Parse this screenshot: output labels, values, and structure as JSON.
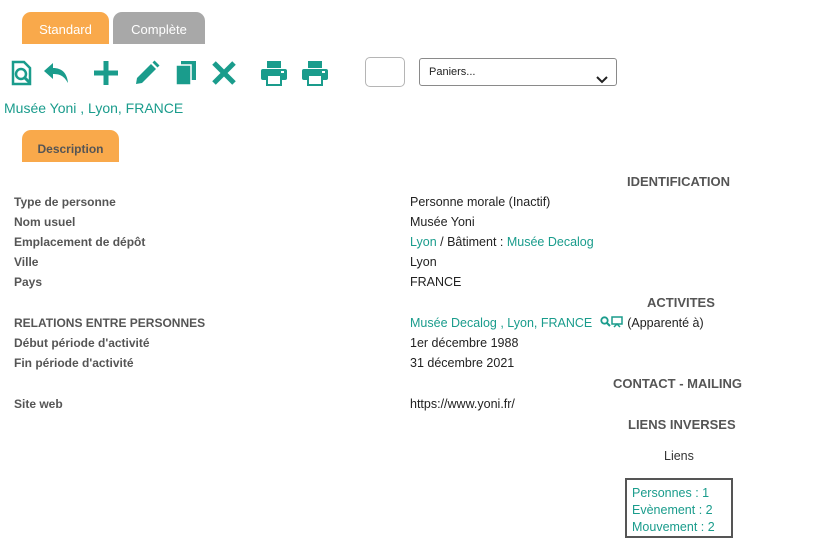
{
  "tabs": {
    "standard": "Standard",
    "complete": "Complète"
  },
  "toolbar": {
    "icons": [
      "search-document-icon",
      "undo-icon",
      "add-icon",
      "edit-icon",
      "copy-icon",
      "delete-icon",
      "print-icon",
      "print-alt-icon"
    ],
    "accent_color": "#1a9c8c",
    "basket_select": "Paniers..."
  },
  "header": {
    "title": "Musée Yoni , Lyon, FRANCE"
  },
  "description_tab": "Description",
  "sections": {
    "identification": "IDENTIFICATION",
    "activites": "ACTIVITES",
    "contact": "CONTACT - MAILING",
    "liens_inverses": "LIENS INVERSES"
  },
  "fields": {
    "type_label": "Type de personne",
    "type_value": "Personne morale (Inactif)",
    "nom_label": "Nom usuel",
    "nom_value": "Musée Yoni",
    "emplacement_label": "Emplacement de dépôt",
    "emplacement_lyon": "Lyon",
    "emplacement_sep": "/  Bâtiment :",
    "emplacement_batiment": "Musée Decalog",
    "ville_label": "Ville",
    "ville_value": "Lyon",
    "pays_label": "Pays",
    "pays_value": "FRANCE",
    "relations_label": "RELATIONS ENTRE PERSONNES",
    "relations_link": "Musée Decalog , Lyon, FRANCE",
    "relations_suffix": "(Apparenté à)",
    "debut_label": "Début période d'activité",
    "debut_value": "1er décembre 1988",
    "fin_label": "Fin période d'activité",
    "fin_value": "31 décembre 2021",
    "site_label": "Site web",
    "site_value": "https://www.yoni.fr/"
  },
  "liens": {
    "title": "Liens",
    "items": [
      "Personnes : 1",
      "Evènement : 2",
      "Mouvement : 2"
    ]
  }
}
